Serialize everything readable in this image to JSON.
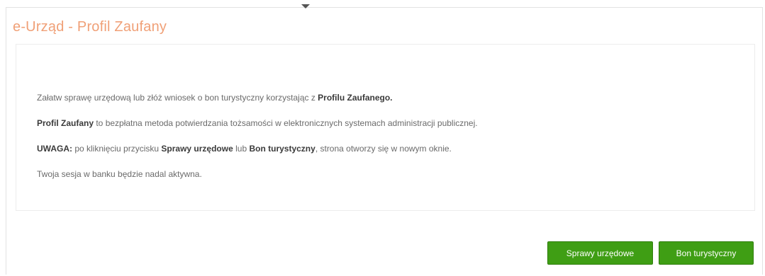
{
  "title": "e-Urząd - Profil Zaufany",
  "content": {
    "line1_pre": "Załatw sprawę urzędową lub złóż wniosek o bon turystyczny korzystając z ",
    "line1_bold": "Profilu Zaufanego.",
    "line2_bold": "Profil Zaufany",
    "line2_post": " to bezpłatna metoda potwierdzania tożsamości w elektronicznych systemach administracji publicznej.",
    "line3_bold1": "UWAGA:",
    "line3_mid1": " po kliknięciu przycisku ",
    "line3_bold2": "Sprawy urzędowe",
    "line3_mid2": " lub ",
    "line3_bold3": "Bon turystyczny",
    "line3_post": ", strona otworzy się w nowym oknie.",
    "line4": "Twoja sesja w banku będzie nadal aktywna."
  },
  "buttons": {
    "sprawy_label": "Sprawy urzędowe",
    "bon_label": "Bon turystyczny"
  },
  "colors": {
    "title": "#f0a077",
    "button_bg": "#3f9e14"
  },
  "icons": {
    "top_indicator": "caret-down-icon"
  }
}
